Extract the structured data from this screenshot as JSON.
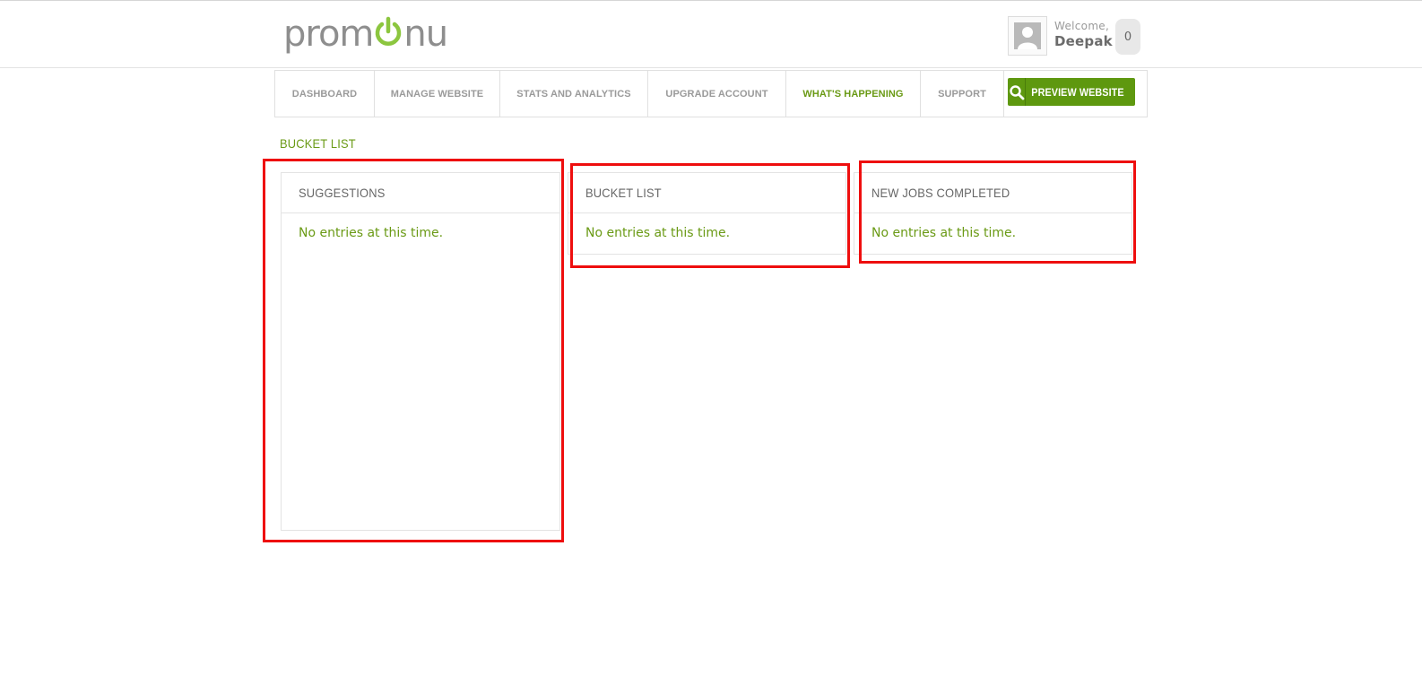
{
  "header": {
    "logo": {
      "left_text": "prom",
      "right_text": "nu",
      "accent_color": "#8cc63f"
    },
    "user": {
      "avatar_icon": "user-avatar-icon",
      "welcome_label": "Welcome,",
      "name": "Deepak"
    },
    "notifications": {
      "count": "0"
    }
  },
  "nav": {
    "items": [
      {
        "label": "DASHBOARD",
        "active": false
      },
      {
        "label": "MANAGE WEBSITE",
        "active": false
      },
      {
        "label": "STATS AND ANALYTICS",
        "active": false
      },
      {
        "label": "UPGRADE ACCOUNT",
        "active": false
      },
      {
        "label": "WHAT'S HAPPENING",
        "active": true
      },
      {
        "label": "SUPPORT",
        "active": false
      }
    ],
    "preview_button": {
      "label": "PREVIEW WEBSITE",
      "icon": "search-icon",
      "color": "#5e980f"
    }
  },
  "page": {
    "title": "BUCKET LIST"
  },
  "panels": [
    {
      "title": "SUGGESTIONS",
      "message": "No entries at this time."
    },
    {
      "title": "BUCKET LIST",
      "message": "No entries at this time."
    },
    {
      "title": "NEW JOBS COMPLETED",
      "message": "No entries at this time."
    }
  ],
  "colors": {
    "accent_green": "#6a9a15",
    "highlight_red": "#ee0e0e"
  }
}
